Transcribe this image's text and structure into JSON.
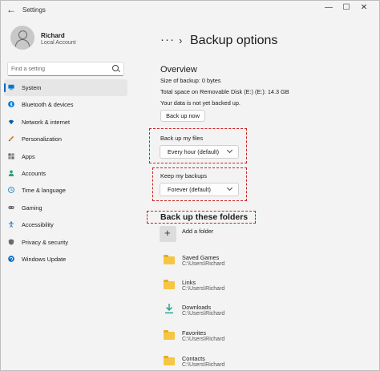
{
  "window": {
    "title": "Settings",
    "back_glyph": "←",
    "controls": [
      "—",
      "☐",
      "✕"
    ]
  },
  "user": {
    "name": "Richard",
    "account_type": "Local Account",
    "avatar_icon": "person-icon"
  },
  "search": {
    "placeholder": "Find a setting",
    "icon": "search-icon"
  },
  "sidebar": {
    "items": [
      {
        "label": "System",
        "icon": "monitor-icon",
        "active": true,
        "color": "#0078d4"
      },
      {
        "label": "Bluetooth & devices",
        "icon": "bluetooth-icon",
        "color": "#0078d4"
      },
      {
        "label": "Network & internet",
        "icon": "wifi-icon",
        "color": "#0b5fa8"
      },
      {
        "label": "Personalization",
        "icon": "brush-icon",
        "color": "#d47a28"
      },
      {
        "label": "Apps",
        "icon": "apps-icon",
        "color": "#6a6a6a"
      },
      {
        "label": "Accounts",
        "icon": "person-icon",
        "color": "#2aa37a"
      },
      {
        "label": "Time & language",
        "icon": "globe-clock-icon",
        "color": "#2a83c4"
      },
      {
        "label": "Gaming",
        "icon": "controller-icon",
        "color": "#6a6a6a"
      },
      {
        "label": "Accessibility",
        "icon": "accessibility-icon",
        "color": "#1b6fbf"
      },
      {
        "label": "Privacy & security",
        "icon": "shield-icon",
        "color": "#6a6a6a"
      },
      {
        "label": "Windows Update",
        "icon": "update-icon",
        "color": "#0a72c8"
      }
    ]
  },
  "breadcrumb": {
    "more": "···",
    "separator": "›",
    "title": "Backup options"
  },
  "overview": {
    "heading": "Overview",
    "size_line": "Size of backup: 0 bytes",
    "space_line": "Total space on Removable Disk (E:) (E:): 14.3 GB",
    "status_line": "Your data is not yet backed up.",
    "backup_button": "Back up now"
  },
  "backup_files": {
    "label": "Back up my files",
    "value": "Every hour (default)"
  },
  "keep_backups": {
    "label": "Keep my backups",
    "value": "Forever (default)"
  },
  "folders": {
    "heading": "Back up these folders",
    "add_glyph": "+",
    "add_label": "Add a folder",
    "items": [
      {
        "name": "Saved Games",
        "path": "C:\\Users\\Richard",
        "icon": "folder-icon"
      },
      {
        "name": "Links",
        "path": "C:\\Users\\Richard",
        "icon": "folder-icon"
      },
      {
        "name": "Downloads",
        "path": "C:\\Users\\Richard",
        "icon": "download-icon"
      },
      {
        "name": "Favorites",
        "path": "C:\\Users\\Richard",
        "icon": "folder-icon"
      },
      {
        "name": "Contacts",
        "path": "C:\\Users\\Richard",
        "icon": "folder-icon"
      }
    ]
  },
  "colors": {
    "accent": "#0067c0",
    "highlight_dash": "#cc1f1f",
    "background": "#f3f3f3"
  }
}
